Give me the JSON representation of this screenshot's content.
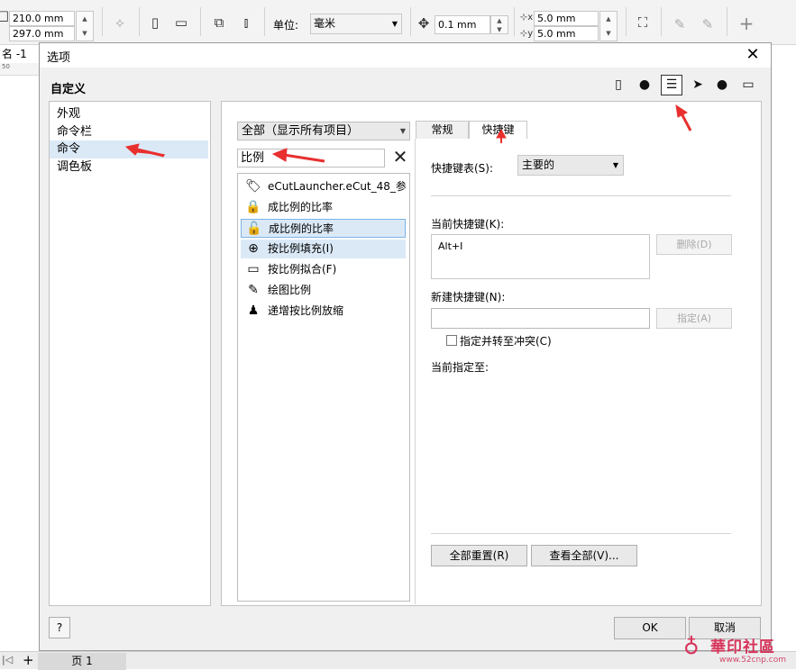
{
  "toolbar": {
    "page_width": "210.0 mm",
    "page_height": "297.0 mm",
    "units_label": "单位:",
    "units_value": "毫米",
    "nudge_value": "0.1 mm",
    "dup_x": "5.0 mm",
    "dup_y": "5.0 mm"
  },
  "document": {
    "tab_title": "名 -1",
    "ruler_mark": "50",
    "page_tab": "页 1"
  },
  "dialog": {
    "title": "选项",
    "heading": "自定义",
    "tree_items": [
      "外观",
      "命令栏",
      "命令",
      "调色板"
    ],
    "filter_value": "全部（显示所有项目）",
    "search_value": "比例",
    "commands": [
      {
        "label": "eCutLauncher.eCut_48_参...",
        "icon": "tag-icon"
      },
      {
        "label": "成比例的比率",
        "icon": "lock-closed-icon"
      },
      {
        "label": "成比例的比率",
        "icon": "lock-open-icon"
      },
      {
        "label": "按比例填充(I)",
        "icon": "fill-proportional-icon"
      },
      {
        "label": "按比例拟合(F)",
        "icon": "fit-proportional-icon"
      },
      {
        "label": "绘图比例",
        "icon": "drawing-scale-icon"
      },
      {
        "label": "递增按比例放缩",
        "icon": "zoom-step-icon"
      }
    ],
    "tabs": [
      "常规",
      "快捷键"
    ],
    "shortcut_table_label": "快捷键表(S):",
    "shortcut_table_value": "主要的",
    "current_shortcut_label": "当前快捷键(K):",
    "current_shortcut_value": "Alt+I",
    "delete_label": "删除(D)",
    "new_shortcut_label": "新建快捷键(N):",
    "new_shortcut_value": "",
    "assign_label": "指定(A)",
    "checkbox_label": "指定并转至冲突(C)",
    "current_assigned_label": "当前指定至:",
    "reset_all_label": "全部重置(R)",
    "view_all_label": "查看全部(V)...",
    "help_label": "?",
    "ok_label": "OK",
    "cancel_label": "取消"
  },
  "watermark": {
    "name": "華印社區",
    "url": "www.52cnp.com"
  },
  "colors": {
    "annotation_arrow": "#e8302f",
    "selection": "#dbe9f7"
  }
}
